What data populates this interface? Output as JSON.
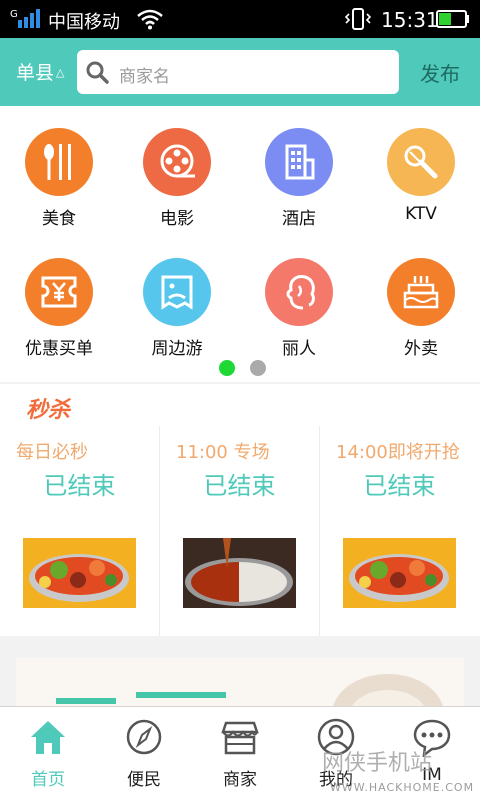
{
  "status_bar": {
    "carrier": "中国移动",
    "time": "15:31",
    "network_badge": "G"
  },
  "header": {
    "city": "单县",
    "search_placeholder": "商家名",
    "publish_label": "发布",
    "brand_color": "#4fc9b9"
  },
  "categories": [
    {
      "label": "美食",
      "icon": "utensils-icon",
      "color": "#f47f2b"
    },
    {
      "label": "电影",
      "icon": "film-reel-icon",
      "color": "#ee6a44"
    },
    {
      "label": "酒店",
      "icon": "hotel-icon",
      "color": "#7b8cf2"
    },
    {
      "label": "KTV",
      "icon": "microphone-icon",
      "color": "#f6b653"
    },
    {
      "label": "优惠买单",
      "icon": "coupon-icon",
      "color": "#f47f2b"
    },
    {
      "label": "周边游",
      "icon": "travel-ticket-icon",
      "color": "#56c6ec"
    },
    {
      "label": "丽人",
      "icon": "beauty-face-icon",
      "color": "#f5796b"
    },
    {
      "label": "外卖",
      "icon": "cake-icon",
      "color": "#f47f2b"
    }
  ],
  "pager": {
    "pages": 2,
    "active_index": 0,
    "active_color": "#1ed836",
    "inactive_color": "#aaaaaa"
  },
  "flash_sale": {
    "title": "秒杀",
    "deals": [
      {
        "label": "每日必秒",
        "status": "已结束",
        "image": "hotpot-photo"
      },
      {
        "label": "11:00 专场",
        "status": "已结束",
        "image": "hotpot-pour-photo"
      },
      {
        "label": "14:00即将开抢",
        "status": "已结束",
        "image": "hotpot-photo"
      }
    ]
  },
  "tabbar": {
    "active_index": 0,
    "tabs": [
      {
        "label": "首页",
        "icon": "home-icon"
      },
      {
        "label": "便民",
        "icon": "compass-icon"
      },
      {
        "label": "商家",
        "icon": "store-icon"
      },
      {
        "label": "我的",
        "icon": "user-icon"
      },
      {
        "label": "IM",
        "icon": "chat-bubble-icon"
      }
    ]
  },
  "watermark": {
    "text": "网侠手机站",
    "url": "WWW.HACKHOME.COM"
  }
}
